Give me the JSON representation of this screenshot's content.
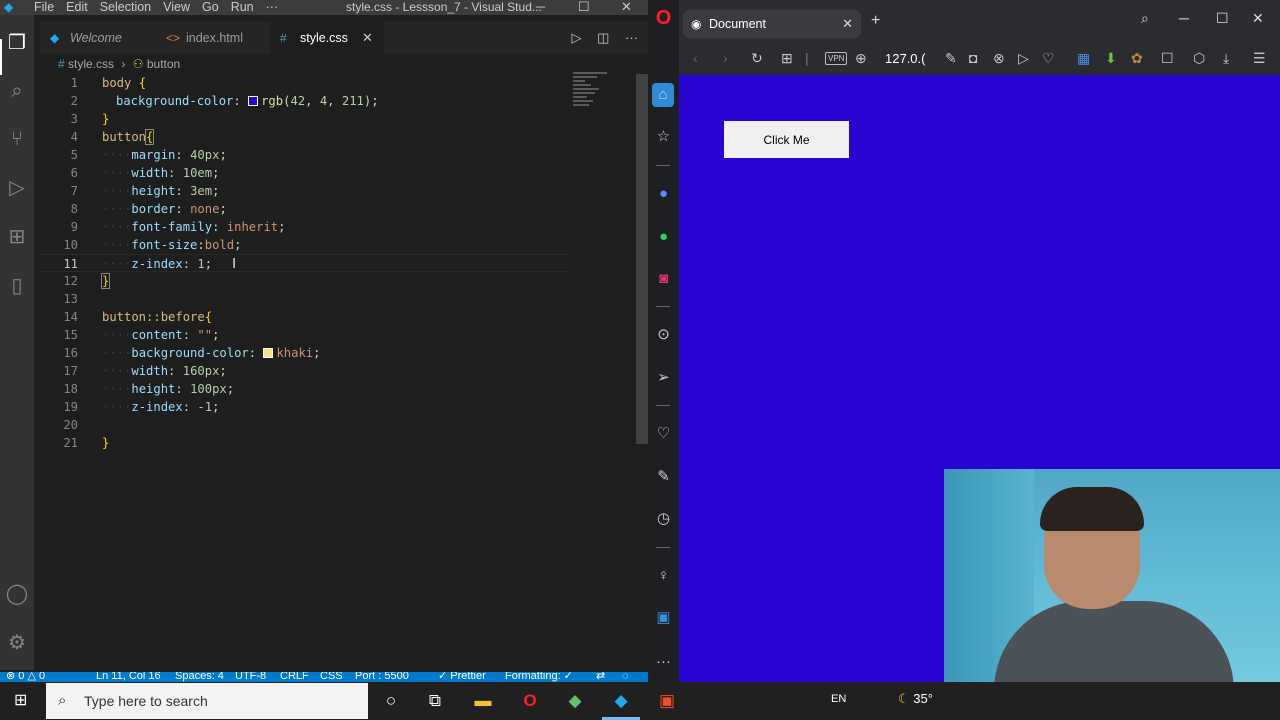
{
  "vscode": {
    "menu": [
      "File",
      "Edit",
      "Selection",
      "View",
      "Go",
      "Run",
      "···"
    ],
    "window_title": "style.css - Lessson_7 - Visual Stud...",
    "tabs": [
      {
        "label": "Welcome",
        "icon": "vscode-logo-icon"
      },
      {
        "label": "index.html",
        "icon": "html-icon"
      },
      {
        "label": "style.css",
        "icon": "css-icon",
        "active": true
      }
    ],
    "breadcrumb": [
      "style.css",
      "button"
    ],
    "code_lines": [
      {
        "n": "1",
        "text": "body {"
      },
      {
        "n": "2",
        "text": "background-color: rgb(42, 4, 211);"
      },
      {
        "n": "3",
        "text": "}"
      },
      {
        "n": "4",
        "text": "button{"
      },
      {
        "n": "5",
        "text": "margin: 40px;"
      },
      {
        "n": "6",
        "text": "width: 10em;"
      },
      {
        "n": "7",
        "text": "height: 3em;"
      },
      {
        "n": "8",
        "text": "border: none;"
      },
      {
        "n": "9",
        "text": "font-family: inherit;"
      },
      {
        "n": "10",
        "text": "font-size:bold;"
      },
      {
        "n": "11",
        "text": "z-index: 1;"
      },
      {
        "n": "12",
        "text": "}"
      },
      {
        "n": "13",
        "text": ""
      },
      {
        "n": "14",
        "text": "button::before{"
      },
      {
        "n": "15",
        "text": "content: \"\";"
      },
      {
        "n": "16",
        "text": "background-color: khaki;"
      },
      {
        "n": "17",
        "text": "width: 160px;"
      },
      {
        "n": "18",
        "text": "height: 100px;"
      },
      {
        "n": "19",
        "text": "z-index: -1;"
      },
      {
        "n": "20",
        "text": ""
      },
      {
        "n": "21",
        "text": "}"
      }
    ],
    "status": {
      "errors": "⊗ 0 △ 0",
      "cursor": "Ln 11, Col 16",
      "spaces": "Spaces: 4",
      "encoding": "UTF-8",
      "eol": "CRLF",
      "lang": "CSS",
      "port": "Port : 5500",
      "prettier": "✓ Prettier",
      "formatting": "Formatting: ✓"
    },
    "colors": {
      "body_swatch": "#2a04d3",
      "khaki_swatch": "#f0e68c"
    }
  },
  "browser": {
    "tab_title": "Document",
    "url": "127.0.(",
    "vpn_label": "VPN",
    "page_button": "Click Me",
    "page_bg": "#2a04d3"
  },
  "taskbar": {
    "search_placeholder": "Type here to search",
    "lang": "EN",
    "temp": "35°"
  }
}
